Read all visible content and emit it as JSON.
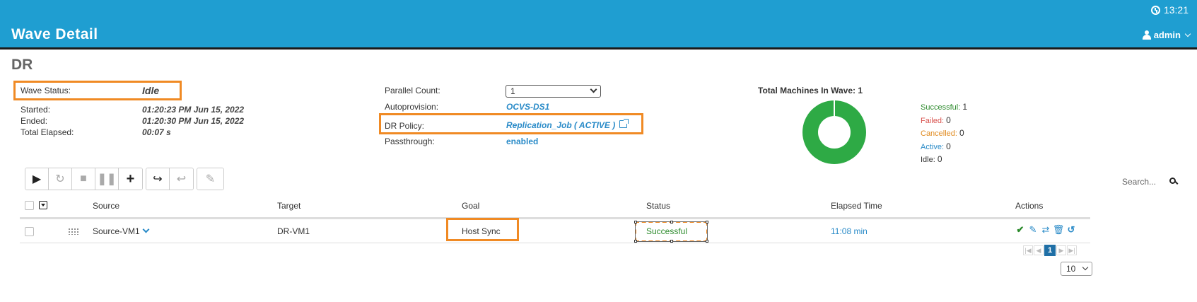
{
  "header": {
    "title": "Wave Detail",
    "clock_time": "13:21",
    "user": "admin"
  },
  "page": {
    "title": "DR"
  },
  "info": {
    "wave_status_label": "Wave Status:",
    "wave_status_value": "Idle",
    "started_label": "Started:",
    "started_value": "01:20:23 PM Jun 15, 2022",
    "ended_label": "Ended:",
    "ended_value": "01:20:30 PM Jun 15, 2022",
    "elapsed_label": "Total Elapsed:",
    "elapsed_value": "00:07 s",
    "parallel_label": "Parallel Count:",
    "parallel_value": "1",
    "autoprovision_label": "Autoprovision:",
    "autoprovision_value": "OCVS-DS1",
    "dr_policy_label": "DR Policy:",
    "dr_policy_value": "Replication_Job ( ACTIVE )",
    "passthrough_label": "Passthrough:",
    "passthrough_value": "enabled"
  },
  "summary": {
    "title": "Total Machines In Wave: 1",
    "legend": [
      {
        "label": "Successful:",
        "count": "1",
        "color": "#2e8b2e"
      },
      {
        "label": "Failed:",
        "count": "0",
        "color": "#d9534f"
      },
      {
        "label": "Cancelled:",
        "count": "0",
        "color": "#e08a1e"
      },
      {
        "label": "Active:",
        "count": "0",
        "color": "#2a8bc8"
      },
      {
        "label": "Idle:",
        "count": "0",
        "color": "#333333"
      }
    ],
    "successful_fraction": 1.0
  },
  "toolbar": {
    "icons": [
      "play-icon",
      "restart-icon",
      "stop-icon",
      "pause-icon",
      "add-icon",
      "redo-icon",
      "undo-icon",
      "edit-icon"
    ]
  },
  "search": {
    "placeholder": "Search..."
  },
  "table": {
    "columns": [
      "Source",
      "Target",
      "Goal",
      "Status",
      "Elapsed Time",
      "Actions"
    ],
    "rows": [
      {
        "source": "Source-VM1",
        "target": "DR-VM1",
        "goal": "Host Sync",
        "status": "Successful",
        "elapsed": "11:08 min"
      }
    ]
  },
  "pagination": {
    "current_page": "1",
    "per_page": "10"
  }
}
